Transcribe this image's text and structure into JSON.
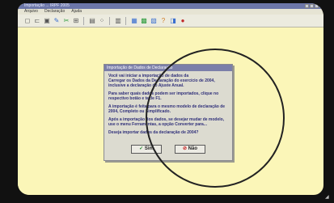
{
  "window": {
    "title": "Importação ... IRPF 2005",
    "menu": [
      "Arquivo",
      "Declaração",
      "Ajuda"
    ]
  },
  "toolbar": {
    "icons": [
      "new-icon",
      "open-icon",
      "save-icon",
      "print-icon",
      "cut-icon",
      "copy-icon",
      "paste-icon",
      "find-icon",
      "export-icon",
      "import-icon",
      "calc-icon",
      "help-icon",
      "exit-icon"
    ]
  },
  "dialog": {
    "title": "Importação de Dados de Declaração",
    "lines": [
      "Você vai iniciar a importação de dados da",
      "Carregar os Dados da Declaração do exercício de 2004, inclusive a declaração do",
      "Ajuste Anual.",
      "Para saber quais dados podem ser importados, clique",
      "no respectivo botão e tecle F1.",
      "A importação é feita para o mesmo modelo de declaração de",
      "2004, Completo ou Simplificado.",
      "Após a importação dos dados, se desejar mudar de modelo, use o",
      "menu Ferramentas, a opção Converter para...",
      "Deseja importar dados da declaração de 2004?"
    ],
    "yes_label": "Sim",
    "no_label": "Não"
  }
}
